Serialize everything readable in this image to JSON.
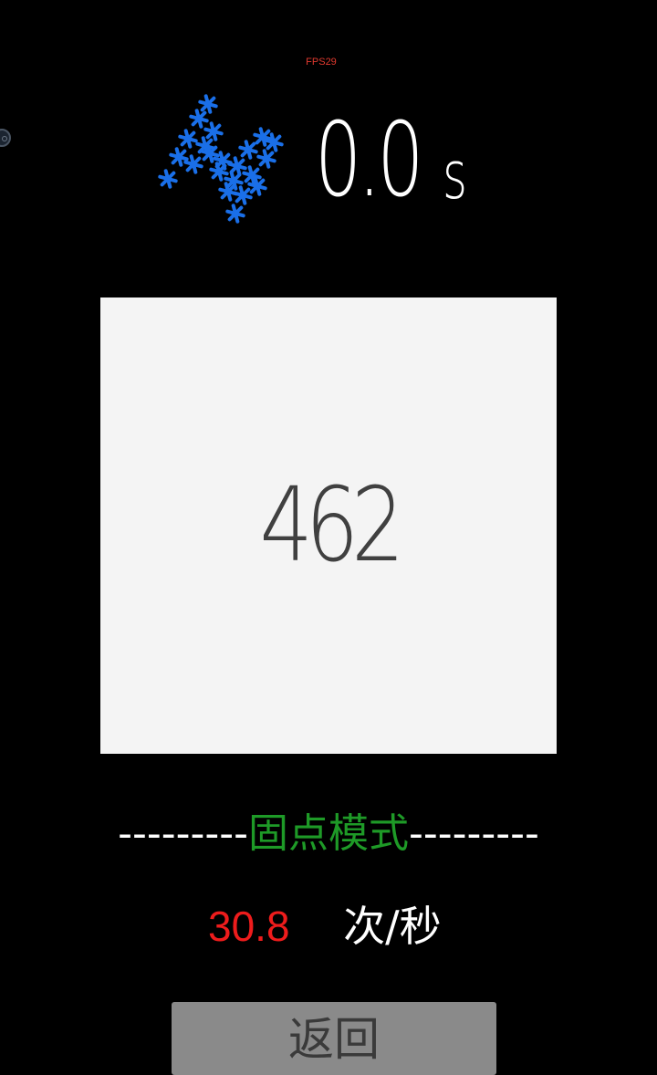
{
  "status": {
    "fps_label": "FPS29"
  },
  "header": {
    "timer_value": "0.0",
    "timer_unit": "s",
    "logo_icon": "blue-asterisk-cluster-icon",
    "logo_color": "#1a6fe8"
  },
  "target": {
    "number": "462",
    "background": "#f4f4f4"
  },
  "mode": {
    "left_dashes": "---------",
    "label": "固点模式",
    "right_dashes": "---------",
    "label_color": "#1e9a27"
  },
  "rate": {
    "value": "30.8",
    "unit": "次/秒",
    "value_color": "#ee1c1c"
  },
  "actions": {
    "back_label": "返回"
  }
}
